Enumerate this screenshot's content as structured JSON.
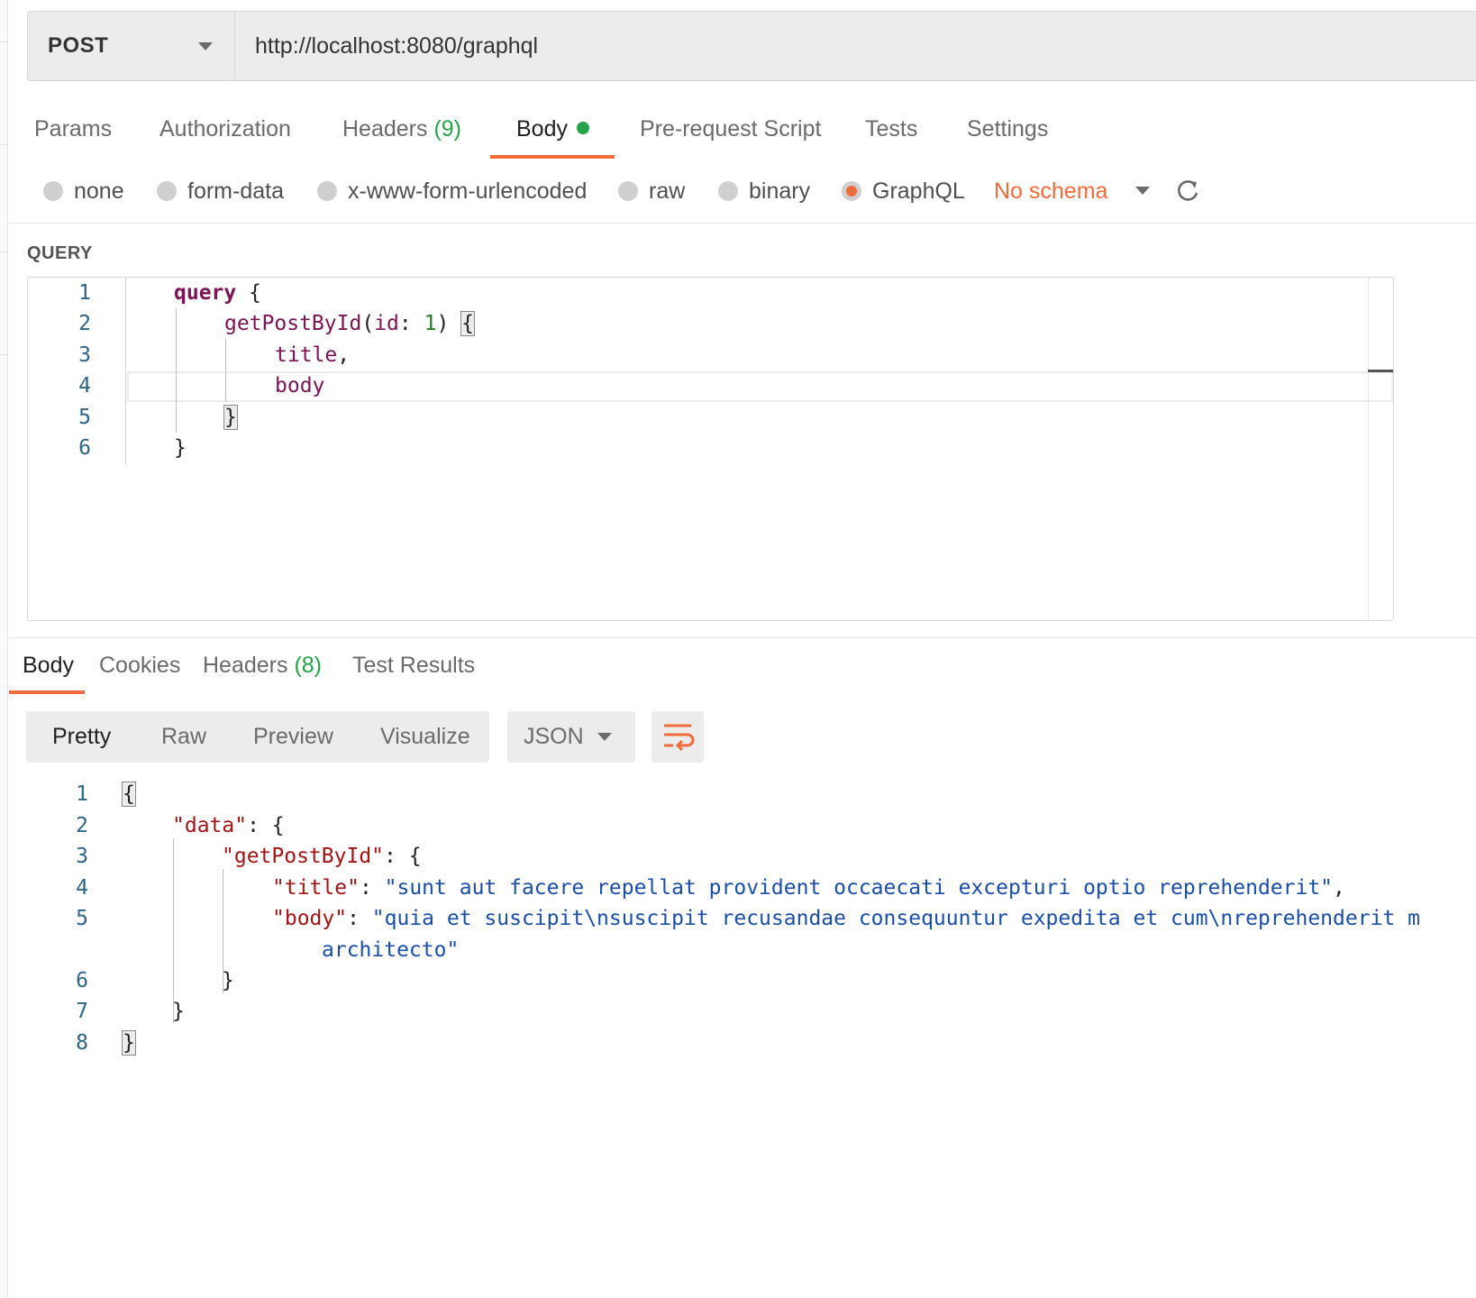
{
  "request": {
    "method": "POST",
    "url": "http://localhost:8080/graphql"
  },
  "request_tabs": {
    "params": "Params",
    "authorization": "Authorization",
    "headers": "Headers",
    "headers_count": "(9)",
    "body": "Body",
    "pre_request": "Pre-request Script",
    "tests": "Tests",
    "settings": "Settings"
  },
  "body_types": {
    "none": "none",
    "form_data": "form-data",
    "urlencoded": "x-www-form-urlencoded",
    "raw": "raw",
    "binary": "binary",
    "graphql": "GraphQL",
    "selected": "GraphQL"
  },
  "schema": {
    "label": "No schema"
  },
  "query_editor": {
    "section_label": "QUERY",
    "line_numbers": [
      "1",
      "2",
      "3",
      "4",
      "5",
      "6"
    ],
    "tokens": {
      "l1_kw": "query",
      "l1_brace": " {",
      "l2_fn": "getPostById",
      "l2_open": "(",
      "l2_arg": "id",
      "l2_colon": ": ",
      "l2_num": "1",
      "l2_close": ") ",
      "l2_brace": "{",
      "l3_field": "title",
      "l3_comma": ",",
      "l4_field": "body",
      "l5_brace": "}",
      "l6_brace": "}"
    }
  },
  "response_tabs": {
    "body": "Body",
    "cookies": "Cookies",
    "headers": "Headers",
    "headers_count": "(8)",
    "test_results": "Test Results"
  },
  "view_modes": {
    "pretty": "Pretty",
    "raw": "Raw",
    "preview": "Preview",
    "visualize": "Visualize"
  },
  "format": {
    "selected": "JSON"
  },
  "response_body": {
    "line_numbers": [
      "1",
      "2",
      "3",
      "4",
      "5",
      "6",
      "7",
      "8"
    ],
    "tokens": {
      "l1": "{",
      "l2_key": "\"data\"",
      "l2_rest": ": {",
      "l3_key": "\"getPostById\"",
      "l3_rest": ": {",
      "l4_key": "\"title\"",
      "l4_colon": ": ",
      "l4_val": "\"sunt aut facere repellat provident occaecati excepturi optio reprehenderit\"",
      "l4_comma": ",",
      "l5_key": "\"body\"",
      "l5_colon": ": ",
      "l5_val": "\"quia et suscipit\\nsuscipit recusandae consequuntur expedita et cum\\nreprehenderit m",
      "l5_cont": "architecto\"",
      "l6": "}",
      "l7": "}",
      "l8": "}"
    }
  }
}
